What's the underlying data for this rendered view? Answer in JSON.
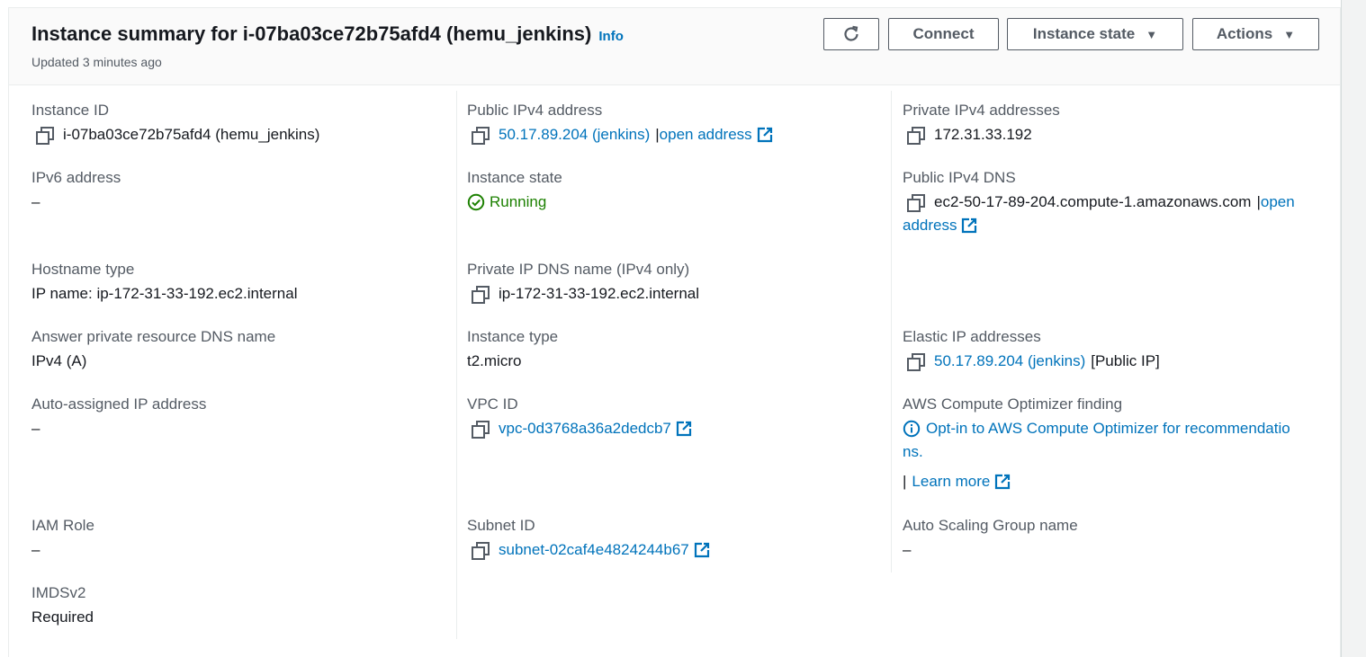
{
  "header": {
    "title": "Instance summary for i-07ba03ce72b75afd4 (hemu_jenkins)",
    "info": "Info",
    "updated": "Updated 3 minutes ago",
    "buttons": {
      "connect": "Connect",
      "instance_state": "Instance state",
      "actions": "Actions"
    },
    "icons": {
      "refresh": "refresh-icon",
      "caret": "caret-down-icon"
    }
  },
  "details": {
    "instance_id": {
      "label": "Instance ID",
      "value": "i-07ba03ce72b75afd4 (hemu_jenkins)"
    },
    "ipv6": {
      "label": "IPv6 address",
      "value": "–"
    },
    "hostname_type": {
      "label": "Hostname type",
      "value": "IP name: ip-172-31-33-192.ec2.internal"
    },
    "answer_dns": {
      "label": "Answer private resource DNS name",
      "value": "IPv4 (A)"
    },
    "auto_ip": {
      "label": "Auto-assigned IP address",
      "value": "–"
    },
    "iam_role": {
      "label": "IAM Role",
      "value": "–"
    },
    "imdsv2": {
      "label": "IMDSv2",
      "value": "Required"
    },
    "public_ipv4": {
      "label": "Public IPv4 address",
      "value": "50.17.89.204 (jenkins)",
      "sep": "|",
      "open": "open address"
    },
    "instance_state": {
      "label": "Instance state",
      "value": "Running"
    },
    "private_dns": {
      "label": "Private IP DNS name (IPv4 only)",
      "value": "ip-172-31-33-192.ec2.internal"
    },
    "instance_type": {
      "label": "Instance type",
      "value": "t2.micro"
    },
    "vpc_id": {
      "label": "VPC ID",
      "value": "vpc-0d3768a36a2dedcb7"
    },
    "subnet_id": {
      "label": "Subnet ID",
      "value": "subnet-02caf4e4824244b67"
    },
    "private_ipv4": {
      "label": "Private IPv4 addresses",
      "value": "172.31.33.192"
    },
    "public_dns": {
      "label": "Public IPv4 DNS",
      "value": "ec2-50-17-89-204.compute-1.amazonaws.com",
      "sep": "|",
      "open1": "open",
      "open2": "address"
    },
    "elastic_ip": {
      "label": "Elastic IP addresses",
      "value": "50.17.89.204 (jenkins)",
      "suffix": "[Public IP]"
    },
    "optimizer": {
      "label": "AWS Compute Optimizer finding",
      "line1": "Opt-in to AWS Compute Optimizer for recommendatio",
      "line2": "ns.",
      "sep": "|",
      "learn": "Learn more"
    },
    "asg": {
      "label": "Auto Scaling Group name",
      "value": "–"
    }
  },
  "colors": {
    "link": "#0073bb",
    "success": "#1d8102",
    "text": "#16191f",
    "muted": "#545b64"
  }
}
